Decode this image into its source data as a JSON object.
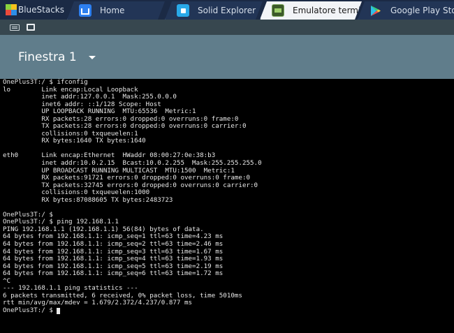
{
  "app": {
    "name": "BlueStacks"
  },
  "tabs": [
    {
      "label": "Home",
      "icon": "home-icon",
      "active": false
    },
    {
      "label": "Solid Explorer",
      "icon": "solid-explorer-icon",
      "active": false
    },
    {
      "label": "Emulatore termin",
      "icon": "terminal-emulator-icon",
      "active": true
    },
    {
      "label": "Google Play Store",
      "icon": "play-store-icon",
      "active": false
    }
  ],
  "toolbar": {
    "window_title": "Finestra 1"
  },
  "terminal": {
    "lines": [
      "OnePlus3T:/ $ ifconfig",
      "lo        Link encap:Local Loopback",
      "          inet addr:127.0.0.1  Mask:255.0.0.0",
      "          inet6 addr: ::1/128 Scope: Host",
      "          UP LOOPBACK RUNNING  MTU:65536  Metric:1",
      "          RX packets:28 errors:0 dropped:0 overruns:0 frame:0",
      "          TX packets:28 errors:0 dropped:0 overruns:0 carrier:0",
      "          collisions:0 txqueuelen:1",
      "          RX bytes:1640 TX bytes:1640",
      "",
      "eth0      Link encap:Ethernet  HWaddr 08:00:27:0e:38:b3",
      "          inet addr:10.0.2.15  Bcast:10.0.2.255  Mask:255.255.255.0",
      "          UP BROADCAST RUNNING MULTICAST  MTU:1500  Metric:1",
      "          RX packets:91721 errors:0 dropped:0 overruns:0 frame:0",
      "          TX packets:32745 errors:0 dropped:0 overruns:0 carrier:0",
      "          collisions:0 txqueuelen:1000",
      "          RX bytes:87088605 TX bytes:2483723",
      "",
      "OnePlus3T:/ $",
      "OnePlus3T:/ $ ping 192.168.1.1",
      "PING 192.168.1.1 (192.168.1.1) 56(84) bytes of data.",
      "64 bytes from 192.168.1.1: icmp_seq=1 ttl=63 time=4.23 ms",
      "64 bytes from 192.168.1.1: icmp_seq=2 ttl=63 time=2.46 ms",
      "64 bytes from 192.168.1.1: icmp_seq=3 ttl=63 time=1.67 ms",
      "64 bytes from 192.168.1.1: icmp_seq=4 ttl=63 time=1.93 ms",
      "64 bytes from 192.168.1.1: icmp_seq=5 ttl=63 time=2.19 ms",
      "64 bytes from 192.168.1.1: icmp_seq=6 ttl=63 time=1.72 ms",
      "^C",
      "--- 192.168.1.1 ping statistics ---",
      "6 packets transmitted, 6 received, 0% packet loss, time 5010ms",
      "rtt min/avg/max/mdev = 1.679/2.372/4.237/0.877 ms"
    ],
    "prompt": "OnePlus3T:/ $ "
  },
  "colors": {
    "tabbar_bg": "#1b2a45",
    "toolbar_bg": "#607d8b",
    "statusbar_bg": "#37474f",
    "terminal_bg": "#000000",
    "terminal_fg": "#e8e8e8"
  }
}
